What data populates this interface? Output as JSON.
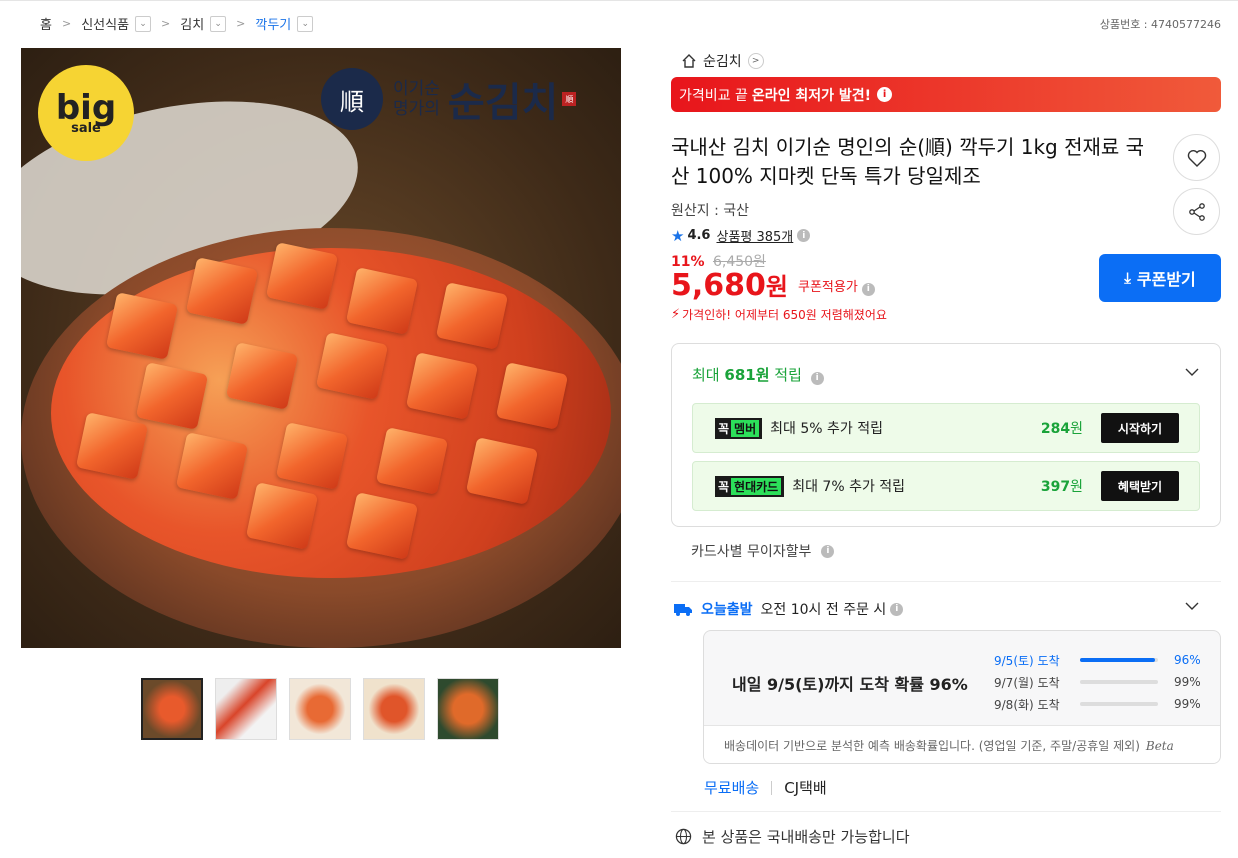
{
  "breadcrumb": {
    "items": [
      {
        "label": "홈"
      },
      {
        "label": "신선식품"
      },
      {
        "label": "김치"
      },
      {
        "label": "깍두기"
      }
    ]
  },
  "product_no": "상품번호 : 4740577246",
  "image": {
    "badge_big": "big",
    "badge_sale": "sale",
    "brand_sub_line1": "이기순",
    "brand_sub_line2": "명가의",
    "brand_name": "순김치",
    "brand_seal": "順",
    "thumbnail_count": 5
  },
  "store": {
    "name": "순김치"
  },
  "banner": {
    "text": "가격비교 끝",
    "strong": "온라인 최저가 발견!"
  },
  "product": {
    "title": "국내산 김치 이기순 명인의 순(順) 깍두기 1kg 전재료 국산 100% 지마켓 단독 특가 당일제조",
    "origin": "원산지 : 국산",
    "rating": "4.6",
    "review_label": "상품평 385개",
    "discount": "11%",
    "original_price": "6,450원",
    "price": "5,680",
    "price_unit": "원",
    "coupon_label": "쿠폰적용가",
    "price_drop": "가격인하! 어제부터 650원 저렴해졌어요"
  },
  "buttons": {
    "coupon": "쿠폰받기"
  },
  "points": {
    "head_prefix": "최대",
    "head_amount": "681원",
    "head_suffix": "적립",
    "rows": [
      {
        "tag_a": "꼭",
        "tag_b": "멤버",
        "text": "최대 5% 추가 적립",
        "amount": "284",
        "unit": "원",
        "action": "시작하기"
      },
      {
        "tag_a": "꼭",
        "tag_b": "현대카드",
        "text": "최대 7% 추가 적립",
        "amount": "397",
        "unit": "원",
        "action": "혜택받기"
      }
    ]
  },
  "installment": "카드사별 무이자할부",
  "shipping": {
    "brand": "오늘출발",
    "cutoff": "오전 10시 전 주문 시",
    "main": "내일 9/5(토)까지 도착 확률 96%",
    "rows": [
      {
        "date": "9/5(토) 도착",
        "pct": "96%",
        "fill": 0.96
      },
      {
        "date": "9/7(월) 도착",
        "pct": "99%",
        "fill": 0
      },
      {
        "date": "9/8(화) 도착",
        "pct": "99%",
        "fill": 0
      }
    ],
    "note": "배송데이터 기반으로 분석한 예측 배송확률입니다. (영업일 기준, 주말/공휴일 제외)",
    "beta": "Beta",
    "free": "무료배송",
    "carrier": "CJ택배",
    "domestic": "본 상품은 국내배송만 가능합니다"
  },
  "colors": {
    "accent": "#0b6ef5",
    "sale": "#e8151b",
    "points": "#1aa33a"
  }
}
